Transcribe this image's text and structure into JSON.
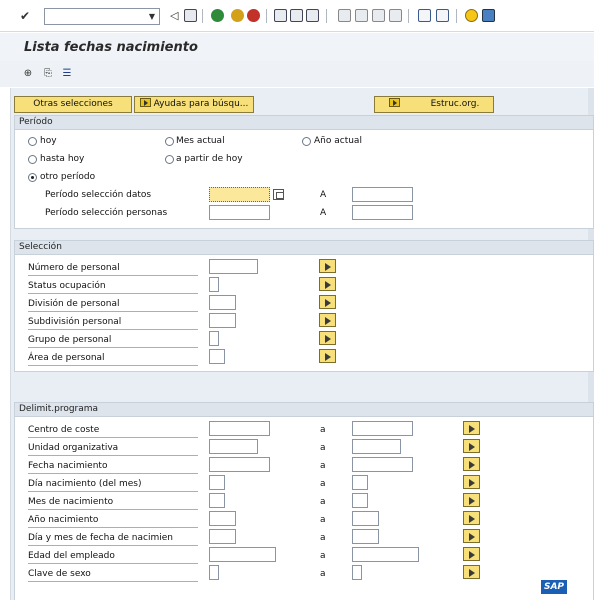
{
  "toolbar": {
    "command_field_value": "",
    "command_field_placeholder": "",
    "icons": [
      "check-icon",
      "back-icon",
      "save-icon",
      "back-green-icon",
      "exit-icon",
      "cancel-icon",
      "print-icon",
      "find-icon",
      "find-next-icon",
      "first-page-icon",
      "prev-page-icon",
      "next-page-icon",
      "last-page-icon",
      "new-session-icon",
      "shortcut-icon",
      "help-icon",
      "layout-icon"
    ]
  },
  "title": "Lista fechas nacimiento",
  "app_toolbar": {
    "icons": [
      "execute-icon",
      "save-variant-icon",
      "selection-options-icon"
    ]
  },
  "buttons": {
    "otras": "Otras selecciones",
    "ayudas": "Ayudas para búsqu...",
    "estruc": "Estruc.org."
  },
  "periodo": {
    "title": "Período",
    "radios": [
      {
        "label": "hoy",
        "checked": false
      },
      {
        "label": "Mes actual",
        "checked": false
      },
      {
        "label": "Año actual",
        "checked": false
      },
      {
        "label": "hasta hoy",
        "checked": false
      },
      {
        "label": "a partir de hoy",
        "checked": false
      },
      {
        "label": "otro período",
        "checked": true
      }
    ],
    "rows": [
      {
        "label": "Período selección datos",
        "to": "A",
        "from_value": "",
        "to_value": ""
      },
      {
        "label": "Período selección personas",
        "to": "A",
        "from_value": "",
        "to_value": ""
      }
    ]
  },
  "seleccion": {
    "title": "Selección",
    "rows": [
      {
        "label": "Número de personal"
      },
      {
        "label": "Status ocupación"
      },
      {
        "label": "División de personal"
      },
      {
        "label": "Subdivisión personal"
      },
      {
        "label": "Grupo de personal"
      },
      {
        "label": "Área de personal"
      }
    ]
  },
  "delimit": {
    "title": "Delimit.programa",
    "rows": [
      {
        "label": "Centro de coste",
        "to": "a"
      },
      {
        "label": "Unidad organizativa",
        "to": "a"
      },
      {
        "label": "Fecha nacimiento",
        "to": "a"
      },
      {
        "label": "Día nacimiento (del mes)",
        "to": "a"
      },
      {
        "label": "Mes de nacimiento",
        "to": "a"
      },
      {
        "label": "Año nacimiento",
        "to": "a"
      },
      {
        "label": "Día y mes de fecha de nacimien",
        "to": "a"
      },
      {
        "label": "Edad del empleado",
        "to": "a"
      },
      {
        "label": "Clave de sexo",
        "to": "a"
      }
    ]
  },
  "logo": "SAP"
}
